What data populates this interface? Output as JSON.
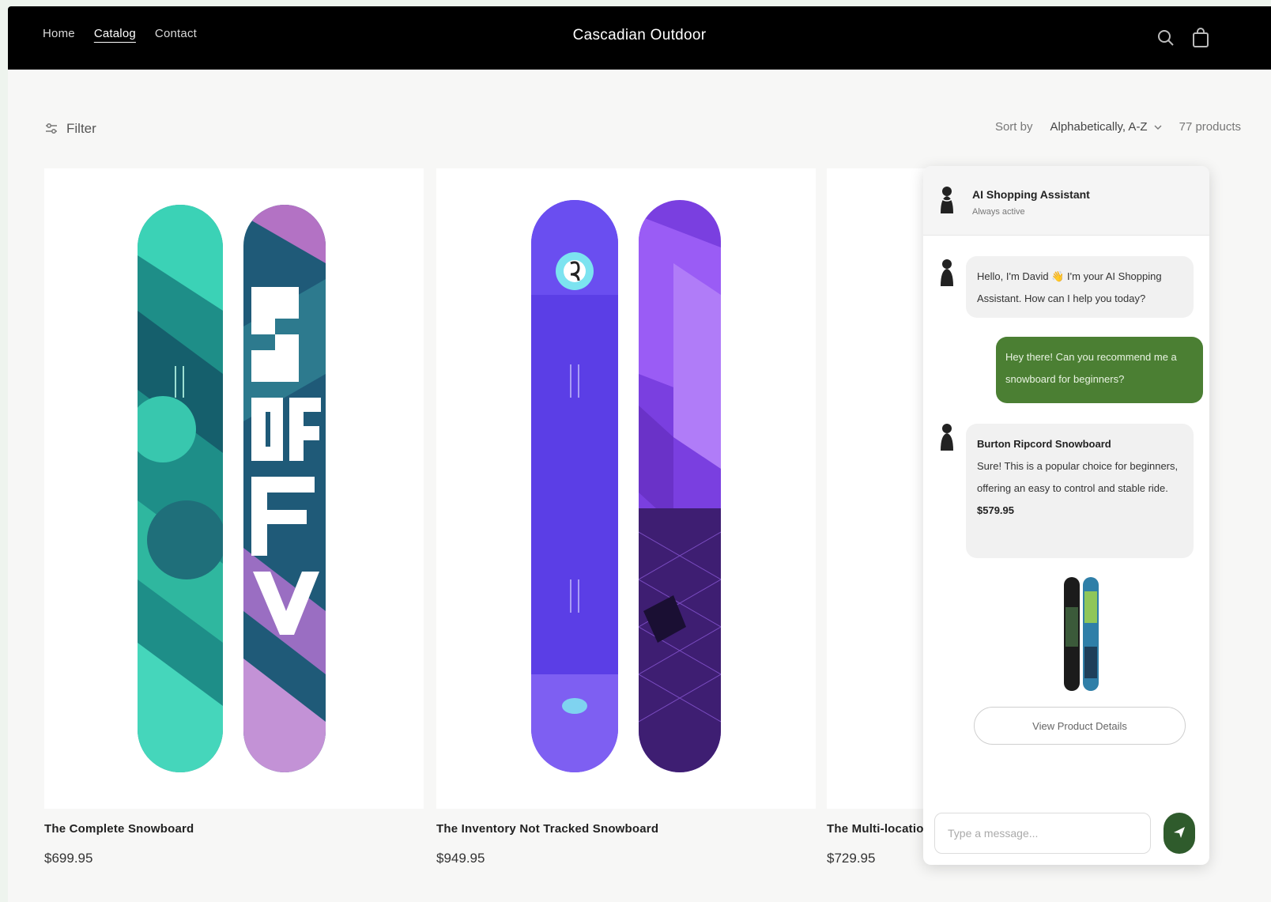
{
  "header": {
    "nav": [
      "Home",
      "Catalog",
      "Contact"
    ],
    "brand": "Cascadian Outdoor",
    "icons": [
      "search-icon",
      "cart-icon"
    ]
  },
  "toolbar": {
    "filter_label": "Filter",
    "sort_label": "Sort by",
    "sort_value": "Alphabetically, A-Z",
    "product_count": "77 products"
  },
  "products": [
    {
      "title": "The Complete Snowboard",
      "price": "$699.95"
    },
    {
      "title": "The Inventory Not Tracked Snowboard",
      "price": "$949.95"
    },
    {
      "title": "The Multi-location",
      "price": "$729.95"
    }
  ],
  "chat": {
    "assistant_name": "AI Shopping Assistant",
    "assistant_status": "Always active",
    "messages": [
      {
        "role": "assistant",
        "text": "Hello, I'm David 👋 I'm your AI Shopping Assistant. How can I help you today?"
      },
      {
        "role": "user",
        "text": "Hey there! Can you recommend me a snowboard for beginners?"
      }
    ],
    "recommendation": {
      "title": "Burton Ripcord Snowboard",
      "description": "Sure! This is a popular choice for beginners, offering an easy to control and stable ride.",
      "price": "$579.95",
      "button_label": "View Product Details"
    },
    "input_placeholder": "Type a message...",
    "colors": {
      "user_bubble": "#4b7f33",
      "send_button": "#2f5b2c"
    }
  }
}
